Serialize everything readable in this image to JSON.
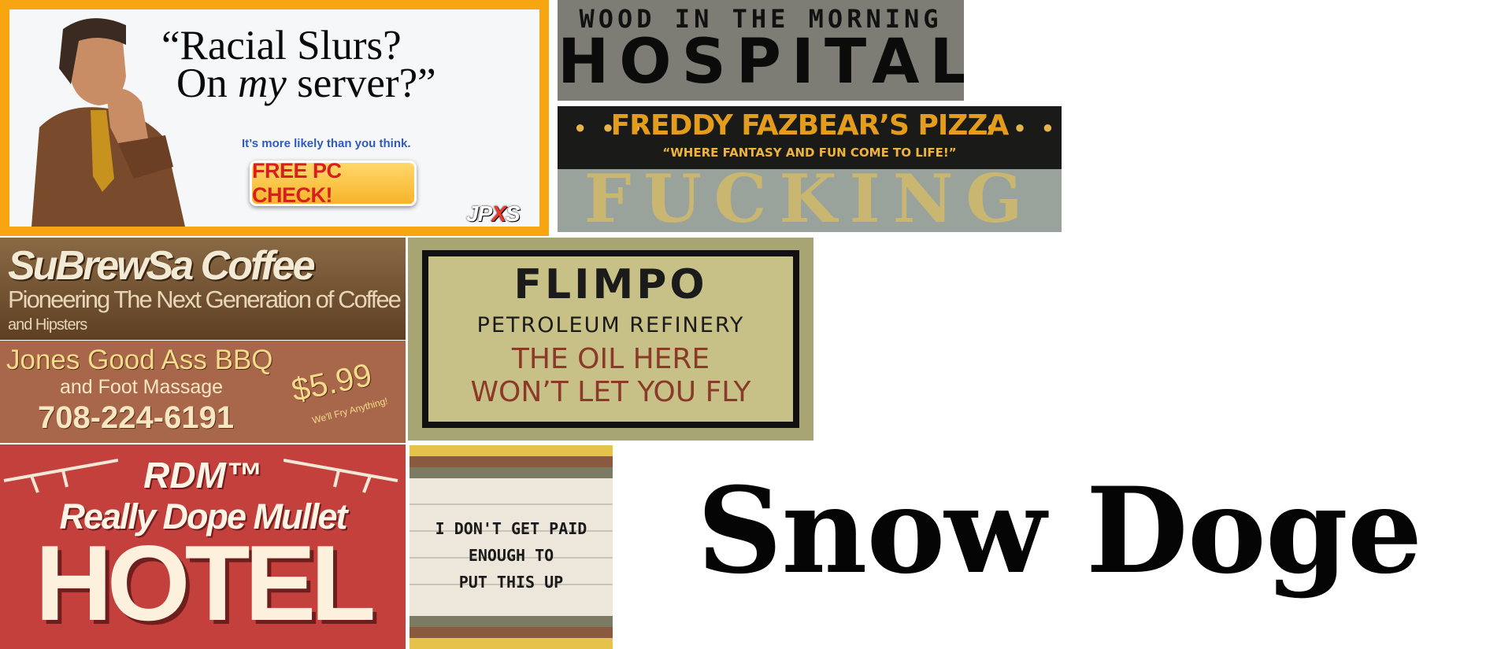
{
  "ad": {
    "quote_line1": "“Racial Slurs?",
    "quote_on": "On ",
    "quote_my": "my",
    "quote_end": " server?”",
    "subtext": "It’s more likely than you think.",
    "button": "FREE PC CHECK!",
    "logo_a": "JP",
    "logo_x": "X",
    "logo_b": "S",
    "colors": {
      "border": "#f7a611",
      "button_text": "#d71f1f"
    }
  },
  "hospital": {
    "line1": "WOOD IN THE MORNING",
    "line2": "HOSPITAL"
  },
  "freddy": {
    "dots_left": "● ● ●",
    "dots_right": "● ● ●",
    "title": "FREDDY FAZBEAR’S PIZZA",
    "tagline": "“WHERE FANTASY AND FUN COME TO LIFE!”"
  },
  "fucking": {
    "word": "FUCKING"
  },
  "coffee": {
    "title": "SuBrewSa Coffee",
    "sub1": "Pioneering The Next Generation of Coffee",
    "sub2": "and Hipsters"
  },
  "bbq": {
    "line1": "Jones Good Ass BBQ",
    "line2": "and Foot Massage",
    "phone": "708-224-6191",
    "price": "$5.99",
    "fry": "We'll Fry Anything!"
  },
  "flimpo": {
    "title": "FLIMPO",
    "sub": "PETROLEUM REFINERY",
    "line1": "THE OIL HERE",
    "line2": "WON’T LET YOU FLY"
  },
  "hotel": {
    "brand": "RDM™",
    "name": "Really Dope Mullet",
    "word": "HOTEL"
  },
  "stripes": {
    "line1": "I DON'T GET PAID",
    "line2": "ENOUGH TO",
    "line3": "PUT THIS UP"
  },
  "snow": {
    "text": "Snow Doge"
  }
}
